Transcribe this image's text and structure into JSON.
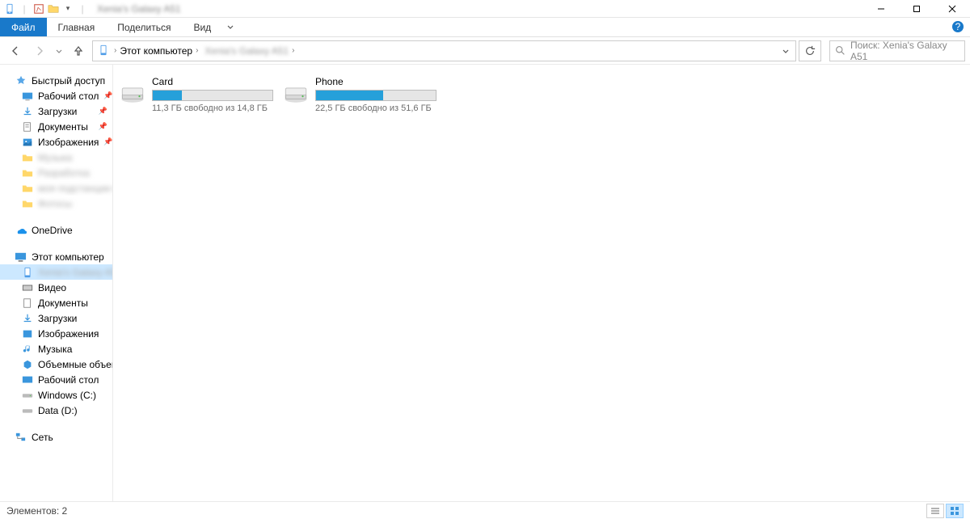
{
  "title_bar": {
    "title": "Xenia's Galaxy A51"
  },
  "window_controls": {
    "min": "—",
    "max": "☐",
    "close": "✕"
  },
  "ribbon": {
    "file": "Файл",
    "home": "Главная",
    "share": "Поделиться",
    "view": "Вид"
  },
  "address": {
    "crumb1": "Этот компьютер",
    "crumb2": "Xenia's Galaxy A51"
  },
  "search": {
    "placeholder": "Поиск: Xenia's Galaxy A51"
  },
  "sidebar": {
    "quick_access": "Быстрый доступ",
    "desktop": "Рабочий стол",
    "downloads": "Загрузки",
    "documents": "Документы",
    "images": "Изображения",
    "blur1": "Музыка",
    "blur2": "Разработка",
    "blur3": "моя подстанции qa",
    "blur4": "Фотосы",
    "onedrive": "OneDrive",
    "this_pc": "Этот компьютер",
    "device_blur": "Xenia's Galaxy A51",
    "video": "Видео",
    "pc_documents": "Документы",
    "pc_downloads": "Загрузки",
    "pc_images": "Изображения",
    "music": "Музыка",
    "objects3d": "Объемные объекты",
    "pc_desktop": "Рабочий стол",
    "windows_c": "Windows (C:)",
    "data_d": "Data (D:)",
    "network": "Сеть"
  },
  "drives": [
    {
      "name": "Card",
      "info": "11,3 ГБ свободно из 14,8 ГБ",
      "used_pct": 24
    },
    {
      "name": "Phone",
      "info": "22,5 ГБ свободно из 51,6 ГБ",
      "used_pct": 56
    }
  ],
  "status": {
    "items": "Элементов: 2"
  }
}
